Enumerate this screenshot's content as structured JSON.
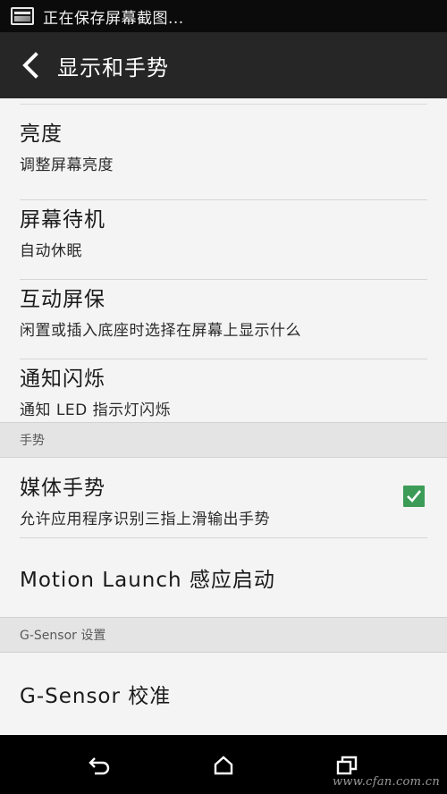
{
  "status_bar": {
    "text": "正在保存屏幕截图...",
    "icon": "screenshot-icon"
  },
  "action_bar": {
    "title": "显示和手势",
    "back_icon": "chevron-left-icon"
  },
  "settings": [
    {
      "title": "亮度",
      "subtitle": "调整屏幕亮度"
    },
    {
      "title": "屏幕待机",
      "subtitle": "自动休眠"
    },
    {
      "title": "互动屏保",
      "subtitle": "闲置或插入底座时选择在屏幕上显示什么"
    },
    {
      "title": "通知闪烁",
      "subtitle": "通知 LED 指示灯闪烁"
    }
  ],
  "gesture_section": {
    "header": "手势",
    "media_gesture": {
      "title": "媒体手势",
      "subtitle": "允许应用程序识别三指上滑输出手势",
      "checked": true
    },
    "motion_launch": {
      "title": "Motion Launch 感应启动"
    }
  },
  "gsensor_section": {
    "header": "G-Sensor 设置",
    "calibrate": {
      "title": "G-Sensor 校准"
    }
  },
  "nav_bar": {
    "back_icon": "back-arrow-icon",
    "home_icon": "home-icon",
    "recents_icon": "recents-icon"
  },
  "watermark": "www.cfan.com.cn",
  "colors": {
    "status_bg": "#0b0b0b",
    "action_bar_bg": "#262626",
    "list_bg": "#f4f4f4",
    "section_bg": "#e4e4e4",
    "checkbox": "#3d9b58"
  }
}
